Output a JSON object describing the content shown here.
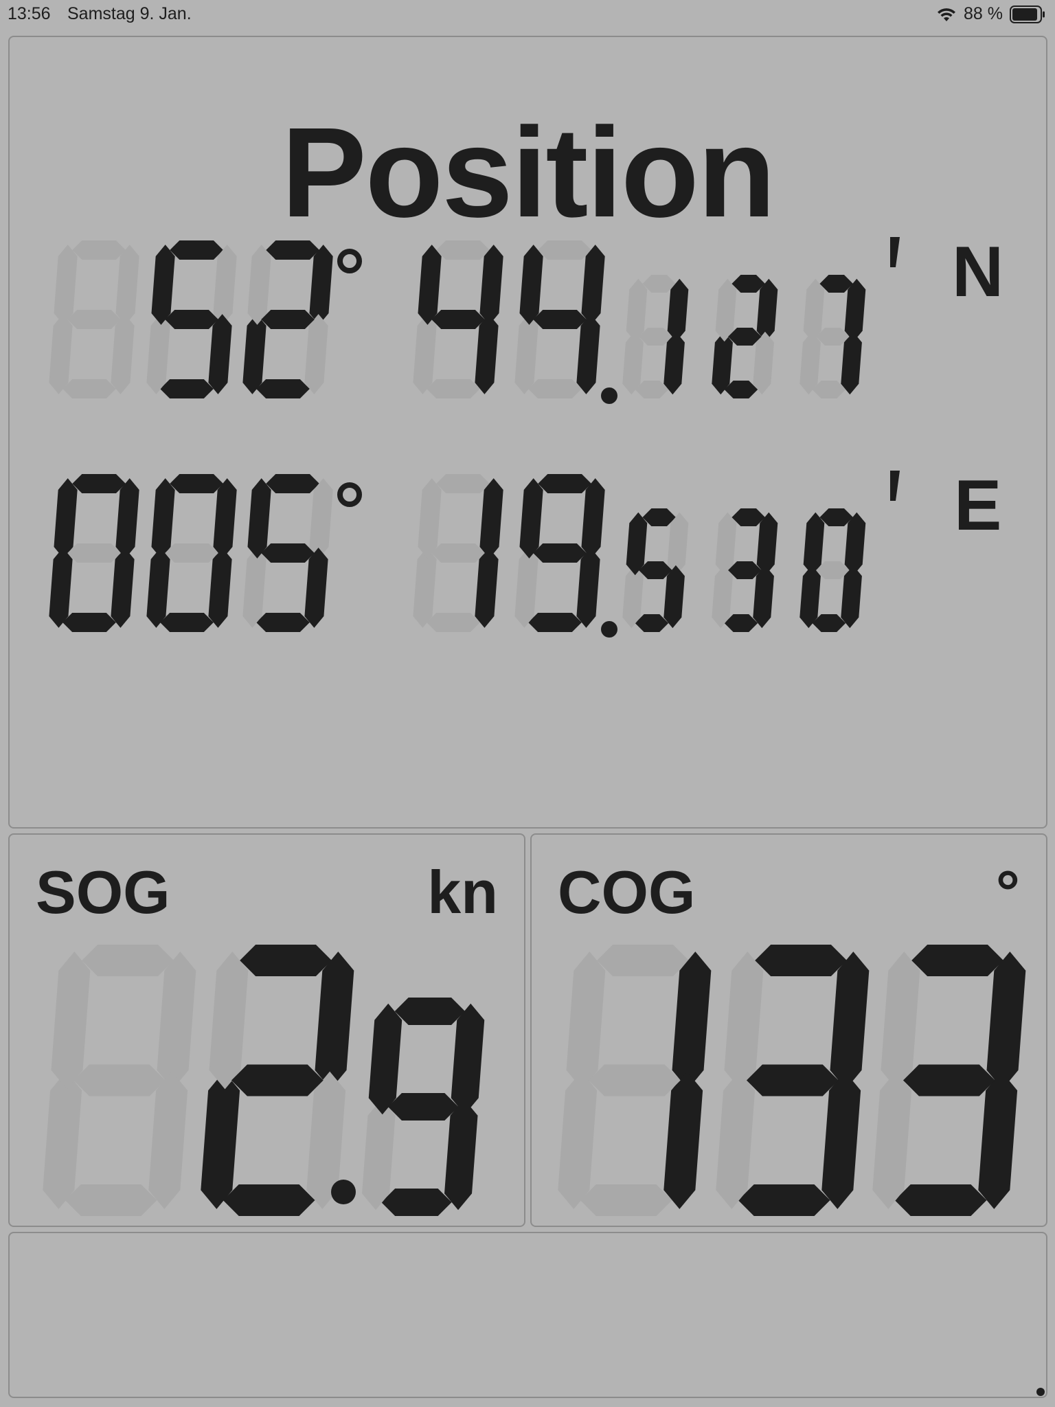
{
  "status_bar": {
    "time": "13:56",
    "date": "Samstag 9. Jan.",
    "battery": "88 %",
    "icons": [
      "wifi-icon",
      "battery-icon"
    ]
  },
  "position": {
    "title": "Position",
    "lat": {
      "digits": "052 44.127",
      "degree_symbol": "°",
      "minute_symbol": "'",
      "hemisphere": "N"
    },
    "lon": {
      "digits": "005 19.530",
      "degree_symbol": "°",
      "minute_symbol": "'",
      "hemisphere": "E"
    }
  },
  "sog": {
    "label": "SOG",
    "unit": "kn",
    "value": "2.9"
  },
  "cog": {
    "label": "COG",
    "unit": "°",
    "value": "133"
  },
  "colors": {
    "background": "#b4b4b4",
    "segment_on": "#1e1e1e",
    "segment_off": "#a9a9a9"
  }
}
